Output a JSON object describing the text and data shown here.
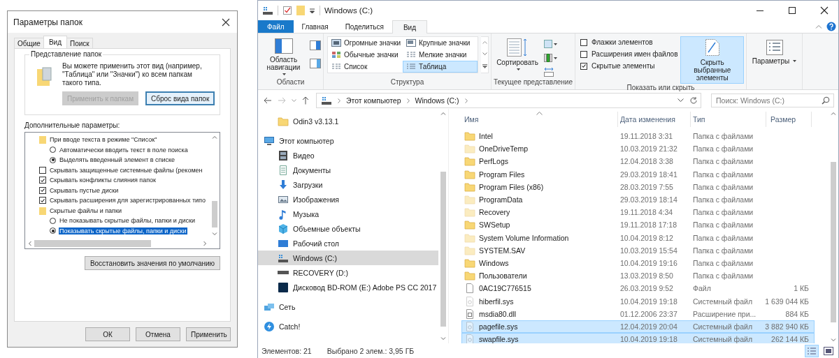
{
  "dialog": {
    "title": "Параметры папок",
    "tabs": [
      {
        "label": "Общие",
        "selected": false
      },
      {
        "label": "Вид",
        "selected": true
      },
      {
        "label": "Поиск",
        "selected": false
      }
    ],
    "folder_views": {
      "title": "Представление папок",
      "text": "Вы можете применить этот вид (например, \"Таблица\" или \"Значки\") ко всем папкам такого типа.",
      "buttons": [
        {
          "label": "Применить к папкам",
          "disabled": true,
          "default": false
        },
        {
          "label": "Сброс вида папок",
          "disabled": false,
          "default": true
        }
      ]
    },
    "advanced": {
      "label": "Дополнительные параметры:",
      "items": [
        {
          "kind": "group",
          "label": "При вводе текста в режиме \"Список\"",
          "children": [
            {
              "kind": "radio",
              "label": "Автоматически вводить текст в поле поиска",
              "selected": false,
              "highlighted": false
            },
            {
              "kind": "radio",
              "label": "Выделять введенный элемент в списке",
              "selected": true,
              "highlighted": false
            }
          ]
        },
        {
          "kind": "checkbox",
          "label": "Скрывать защищенные системные файлы (рекомен",
          "checked": false
        },
        {
          "kind": "checkbox",
          "label": "Скрывать конфликты слияния папок",
          "checked": true
        },
        {
          "kind": "checkbox",
          "label": "Скрывать пустые диски",
          "checked": true
        },
        {
          "kind": "checkbox",
          "label": "Скрывать расширения для зарегистрированных типо",
          "checked": true
        },
        {
          "kind": "group",
          "label": "Скрытые файлы и папки",
          "children": [
            {
              "kind": "radio",
              "label": "Не показывать скрытые файлы, папки и диски",
              "selected": false,
              "highlighted": false
            },
            {
              "kind": "radio",
              "label": "Показывать скрытые файлы, папки и диски",
              "selected": true,
              "highlighted": true
            }
          ]
        }
      ]
    },
    "restore_button": "Восстановить значения по умолчанию",
    "buttons": [
      "ОК",
      "Отмена",
      "Применить"
    ]
  },
  "explorer": {
    "title": "Windows (C:)",
    "ribbon_tabs": [
      {
        "label": "Файл",
        "kind": "file",
        "selected": false
      },
      {
        "label": "Главная",
        "kind": "tab",
        "selected": false
      },
      {
        "label": "Поделиться",
        "kind": "tab",
        "selected": false
      },
      {
        "label": "Вид",
        "kind": "tab",
        "selected": true
      }
    ],
    "panes_group": {
      "label": "Области",
      "nav_button": "Область навигации"
    },
    "layout_group": {
      "label": "Структура",
      "layouts": [
        {
          "label": "Огромные значки",
          "selected": false
        },
        {
          "label": "Крупные значки",
          "selected": false
        },
        {
          "label": "Обычные значки",
          "selected": false
        },
        {
          "label": "Мелкие значки",
          "selected": false
        },
        {
          "label": "Список",
          "selected": false
        },
        {
          "label": "Таблица",
          "selected": true
        }
      ]
    },
    "current_view_group": {
      "label": "Текущее представление",
      "sort_button": "Сортировать"
    },
    "show_hide_group": {
      "label": "Показать или скрыть",
      "checkboxes": [
        {
          "label": "Флажки элементов",
          "checked": false
        },
        {
          "label": "Расширения имен файлов",
          "checked": false
        },
        {
          "label": "Скрытые элементы",
          "checked": true
        }
      ],
      "hide_button": "Скрыть выбранные элементы"
    },
    "options_button": "Параметры",
    "breadcrumb": [
      "Этот компьютер",
      "Windows (C:)"
    ],
    "search": {
      "placeholder": "Поиск: Windows (C:)"
    },
    "nav_tree": [
      {
        "label": "Odin3 v3.13.1",
        "kind": "folder",
        "selected": false
      },
      {
        "label": "Этот компьютер",
        "kind": "computer",
        "selected": false,
        "children": [
          {
            "label": "Видео",
            "kind": "video",
            "selected": false
          },
          {
            "label": "Документы",
            "kind": "documents",
            "selected": false
          },
          {
            "label": "Загрузки",
            "kind": "downloads",
            "selected": false
          },
          {
            "label": "Изображения",
            "kind": "images",
            "selected": false
          },
          {
            "label": "Музыка",
            "kind": "music",
            "selected": false
          },
          {
            "label": "Объемные объекты",
            "kind": "objects3d",
            "selected": false
          },
          {
            "label": "Рабочий стол",
            "kind": "desktop",
            "selected": false
          },
          {
            "label": "Windows (C:)",
            "kind": "system_drive",
            "selected": true
          },
          {
            "label": "RECOVERY (D:)",
            "kind": "drive",
            "selected": false
          },
          {
            "label": "Дисковод BD-ROM (E:) Adobe PS CC 2017",
            "kind": "app_drive",
            "selected": false
          }
        ]
      },
      {
        "label": "Сеть",
        "kind": "network",
        "selected": false
      },
      {
        "label": "Catch!",
        "kind": "catch",
        "selected": false
      }
    ],
    "columns": [
      "Имя",
      "Дата изменения",
      "Тип",
      "Размер"
    ],
    "files": [
      {
        "name": "Intel",
        "date": "19.11.2018 3:31",
        "type": "Папка с файлами",
        "kind": "folder",
        "hidden": false,
        "selected": false
      },
      {
        "name": "OneDriveTemp",
        "date": "10.03.2019 21:32",
        "type": "Папка с файлами",
        "kind": "folder",
        "hidden": true,
        "selected": false
      },
      {
        "name": "PerfLogs",
        "date": "12.04.2018 3:38",
        "type": "Папка с файлами",
        "kind": "folder",
        "hidden": false,
        "selected": false
      },
      {
        "name": "Program Files",
        "date": "29.03.2019 18:41",
        "type": "Папка с файлами",
        "kind": "folder",
        "hidden": false,
        "selected": false
      },
      {
        "name": "Program Files (x86)",
        "date": "28.03.2019 7:55",
        "type": "Папка с файлами",
        "kind": "folder",
        "hidden": false,
        "selected": false
      },
      {
        "name": "ProgramData",
        "date": "29.03.2019 18:14",
        "type": "Папка с файлами",
        "kind": "folder",
        "hidden": true,
        "selected": false
      },
      {
        "name": "Recovery",
        "date": "19.11.2018 4:34",
        "type": "Папка с файлами",
        "kind": "folder",
        "hidden": true,
        "selected": false
      },
      {
        "name": "SWSetup",
        "date": "19.11.2018 17:18",
        "type": "Папка с файлами",
        "kind": "folder",
        "hidden": false,
        "selected": false
      },
      {
        "name": "System Volume Information",
        "date": "10.04.2019 8:12",
        "type": "Папка с файлами",
        "kind": "folder",
        "hidden": true,
        "selected": false
      },
      {
        "name": "SYSTEM.SAV",
        "date": "10.03.2019 15:54",
        "type": "Папка с файлами",
        "kind": "folder",
        "hidden": true,
        "selected": false
      },
      {
        "name": "Windows",
        "date": "10.04.2019 19:16",
        "type": "Папка с файлами",
        "kind": "folder",
        "hidden": false,
        "selected": false
      },
      {
        "name": "Пользователи",
        "date": "13.03.2019 8:50",
        "type": "Папка с файлами",
        "kind": "folder",
        "hidden": false,
        "selected": false
      },
      {
        "name": "0AC19C776515",
        "date": "26.03.2019 9:52",
        "type": "Файл",
        "size": "1 КБ",
        "kind": "file",
        "hidden": false,
        "selected": false
      },
      {
        "name": "hiberfil.sys",
        "date": "10.04.2019 19:18",
        "type": "Системный файл",
        "size": "1 639 044 КБ",
        "kind": "system",
        "hidden": true,
        "selected": false
      },
      {
        "name": "msdia80.dll",
        "date": "01.12.2006 23:37",
        "type": "Расширение при...",
        "size": "884 КБ",
        "kind": "library",
        "hidden": false,
        "selected": false
      },
      {
        "name": "pagefile.sys",
        "date": "12.04.2019 20:04",
        "type": "Системный файл",
        "size": "3 882 940 КБ",
        "kind": "system",
        "hidden": true,
        "selected": true
      },
      {
        "name": "swapfile.sys",
        "date": "10.04.2019 19:18",
        "type": "Системный файл",
        "size": "262 144 КБ",
        "kind": "system",
        "hidden": true,
        "selected": true
      }
    ],
    "status": {
      "count": "Элементов: 21",
      "selection": "Выбрано 2 элем.: 3,95 ГБ"
    },
    "view_buttons": [
      {
        "kind": "details",
        "selected": true
      },
      {
        "kind": "large_icons",
        "selected": false
      }
    ]
  }
}
